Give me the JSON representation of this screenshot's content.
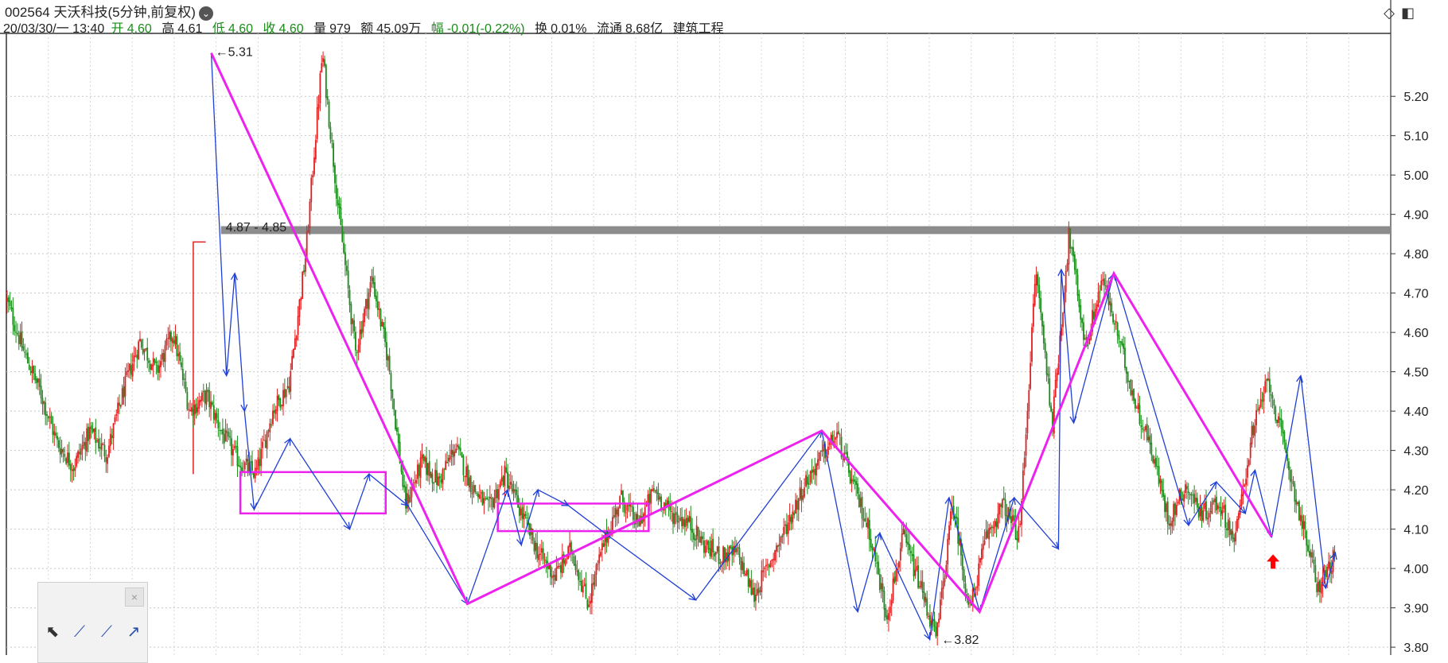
{
  "header": {
    "title": "002564 天沃科技(5分钟,前复权)",
    "date_time": "20/03/30/一 13:40",
    "open_label": "开",
    "open": "4.60",
    "high_label": "高",
    "high": "4.61",
    "low_label": "低",
    "low": "4.60",
    "close_label": "收",
    "close": "4.60",
    "volume_label": "量",
    "volume": "979",
    "amount_label": "额",
    "amount": "45.09万",
    "change_label": "幅",
    "change": "-0.01(-0.22%)",
    "turnover_label": "换",
    "turnover": "0.01%",
    "float_label": "流通",
    "float": "8.68亿",
    "industry": "建筑工程"
  },
  "icons": {
    "dropdown": "chevron-down-icon",
    "diamond": "diamond-icon",
    "panel": "panel-toggle-icon"
  },
  "colors": {
    "up": "#e02020",
    "down": "#1a8c1a",
    "pen": "#1f3fd6",
    "segment": "#ee22ee",
    "resistance": "#8c8c8c",
    "signal": "#ff0000"
  },
  "chart_data": {
    "type": "candlestick",
    "y_axis_ticks": [
      "5.20",
      "5.10",
      "5.00",
      "4.90",
      "4.80",
      "4.70",
      "4.60",
      "4.50",
      "4.40",
      "4.30",
      "4.20",
      "4.10",
      "4.00",
      "3.90",
      "3.80"
    ],
    "ylim": [
      3.78,
      5.36
    ],
    "grid": true,
    "price_path": [
      4.68,
      4.55,
      4.45,
      4.32,
      4.26,
      4.35,
      4.29,
      4.45,
      4.58,
      4.5,
      4.6,
      4.4,
      4.44,
      4.34,
      4.27,
      4.24,
      4.4,
      4.47,
      4.8,
      5.31,
      4.9,
      4.55,
      4.74,
      4.52,
      4.16,
      4.27,
      4.22,
      4.31,
      4.21,
      4.15,
      4.24,
      4.14,
      4.04,
      3.98,
      4.05,
      3.91,
      4.07,
      4.18,
      4.11,
      4.2,
      4.14,
      4.12,
      4.06,
      4.03,
      4.04,
      3.93,
      4.02,
      4.11,
      4.21,
      4.28,
      4.34,
      4.21,
      4.09,
      3.88,
      4.08,
      3.96,
      3.82,
      4.17,
      3.89,
      4.08,
      4.16,
      4.08,
      4.76,
      4.37,
      4.85,
      4.56,
      4.74,
      4.58,
      4.42,
      4.3,
      4.12,
      4.21,
      4.14,
      4.17,
      4.07,
      4.34,
      4.48,
      4.3,
      4.12,
      3.95,
      4.03
    ],
    "annotations": [
      {
        "text": "5.31",
        "x": 0.1475,
        "y": 5.31
      },
      {
        "text": "4.87 - 4.85",
        "x": 0.155,
        "y": 4.865
      },
      {
        "text": "3.82",
        "x": 0.672,
        "y": 3.82
      }
    ],
    "resistance_level": [
      4.85,
      4.87
    ],
    "pens": [
      [
        0.148,
        5.31
      ],
      [
        0.159,
        4.49
      ],
      [
        0.165,
        4.75
      ],
      [
        0.172,
        4.4
      ],
      [
        0.179,
        4.15
      ],
      [
        0.205,
        4.33
      ],
      [
        0.248,
        4.1
      ],
      [
        0.262,
        4.24
      ],
      [
        0.29,
        4.16
      ],
      [
        0.333,
        3.91
      ],
      [
        0.362,
        4.2
      ],
      [
        0.372,
        4.06
      ],
      [
        0.384,
        4.2
      ],
      [
        0.406,
        4.16
      ],
      [
        0.436,
        4.08
      ],
      [
        0.498,
        3.92
      ],
      [
        0.589,
        4.35
      ],
      [
        0.615,
        3.89
      ],
      [
        0.631,
        4.09
      ],
      [
        0.667,
        3.82
      ],
      [
        0.681,
        4.18
      ],
      [
        0.703,
        3.89
      ],
      [
        0.728,
        4.18
      ],
      [
        0.76,
        4.05
      ],
      [
        0.762,
        4.76
      ],
      [
        0.771,
        4.37
      ],
      [
        0.8,
        4.75
      ],
      [
        0.854,
        4.11
      ],
      [
        0.874,
        4.22
      ],
      [
        0.895,
        4.14
      ],
      [
        0.902,
        4.25
      ],
      [
        0.914,
        4.08
      ],
      [
        0.935,
        4.49
      ],
      [
        0.953,
        3.95
      ],
      [
        0.96,
        4.04
      ]
    ],
    "segments": [
      [
        0.148,
        5.31
      ],
      [
        0.333,
        3.91
      ],
      [
        0.589,
        4.35
      ],
      [
        0.703,
        3.89
      ],
      [
        0.8,
        4.75
      ],
      [
        0.914,
        4.08
      ]
    ],
    "pivot_boxes": [
      {
        "x0": 0.169,
        "x1": 0.274,
        "y_low": 4.14,
        "y_high": 4.245
      },
      {
        "x0": 0.355,
        "x1": 0.464,
        "y_low": 4.095,
        "y_high": 4.165
      }
    ],
    "signal_arrow": {
      "x": 0.915,
      "y": 4.04
    },
    "step_line": [
      [
        0.135,
        4.24
      ],
      [
        0.135,
        4.83
      ],
      [
        0.144,
        4.83
      ]
    ]
  }
}
